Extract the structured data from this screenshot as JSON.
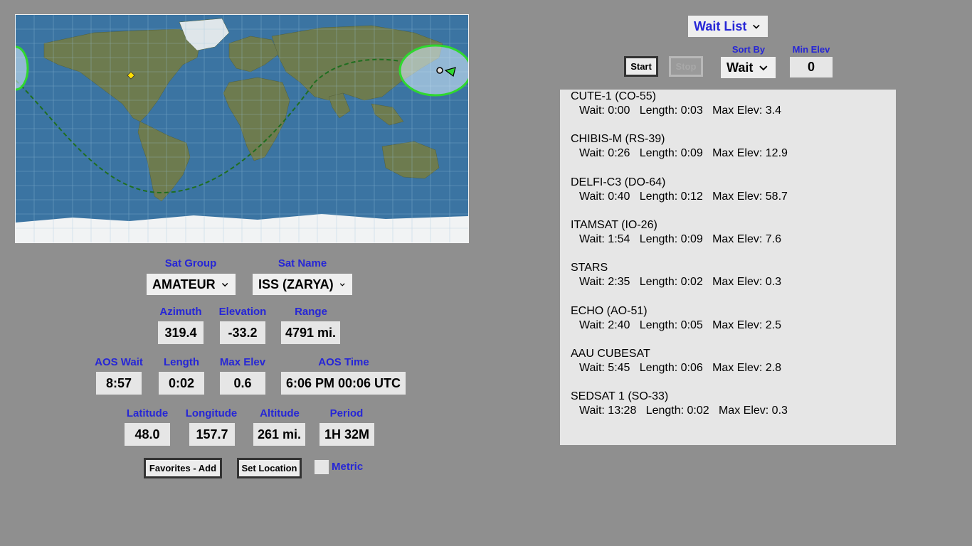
{
  "satellite": {
    "group_label": "Sat Group",
    "group_value": "AMATEUR",
    "name_label": "Sat Name",
    "name_value": "ISS (ZARYA)"
  },
  "readouts": {
    "azimuth_label": "Azimuth",
    "azimuth": "319.4",
    "elevation_label": "Elevation",
    "elevation": "-33.2",
    "range_label": "Range",
    "range": "4791 mi.",
    "aos_wait_label": "AOS Wait",
    "aos_wait": "8:57",
    "length_label": "Length",
    "length": "0:02",
    "max_elev_label": "Max Elev",
    "max_elev": "0.6",
    "aos_time_label": "AOS Time",
    "aos_time": "6:06 PM  00:06 UTC",
    "latitude_label": "Latitude",
    "latitude": "48.0",
    "longitude_label": "Longitude",
    "longitude": "157.7",
    "altitude_label": "Altitude",
    "altitude": "261 mi.",
    "period_label": "Period",
    "period": "1H 32M"
  },
  "actions": {
    "favorites_add": "Favorites - Add",
    "set_location": "Set Location",
    "metric_label": "Metric"
  },
  "waitlist": {
    "mode": "Wait List",
    "start": "Start",
    "stop": "Stop",
    "sort_by_label": "Sort By",
    "sort_by_value": "Wait",
    "min_elev_label": "Min Elev",
    "min_elev_value": "0",
    "items": [
      {
        "name": "CUTE-1 (CO-55)",
        "info": "Wait: 0:00   Length: 0:03   Max Elev: 3.4"
      },
      {
        "name": "CHIBIS-M (RS-39)",
        "info": "Wait: 0:26   Length: 0:09   Max Elev: 12.9"
      },
      {
        "name": "DELFI-C3 (DO-64)",
        "info": "Wait: 0:40   Length: 0:12   Max Elev: 58.7"
      },
      {
        "name": "ITAMSAT (IO-26)",
        "info": "Wait: 1:54   Length: 0:09   Max Elev: 7.6"
      },
      {
        "name": "STARS",
        "info": "Wait: 2:35   Length: 0:02   Max Elev: 0.3"
      },
      {
        "name": "ECHO (AO-51)",
        "info": "Wait: 2:40   Length: 0:05   Max Elev: 2.5"
      },
      {
        "name": "AAU CUBESAT",
        "info": "Wait: 5:45   Length: 0:06   Max Elev: 2.8"
      },
      {
        "name": "SEDSAT 1 (SO-33)",
        "info": "Wait: 13:28   Length: 0:02   Max Elev: 0.3"
      }
    ]
  },
  "colors": {
    "label_blue": "#2626d6",
    "background": "#8f8f8f",
    "box": "#e6e6e6",
    "footprint": "#2fd82f",
    "ground_track": "#1f6e1f",
    "home_marker": "#ffe000"
  }
}
